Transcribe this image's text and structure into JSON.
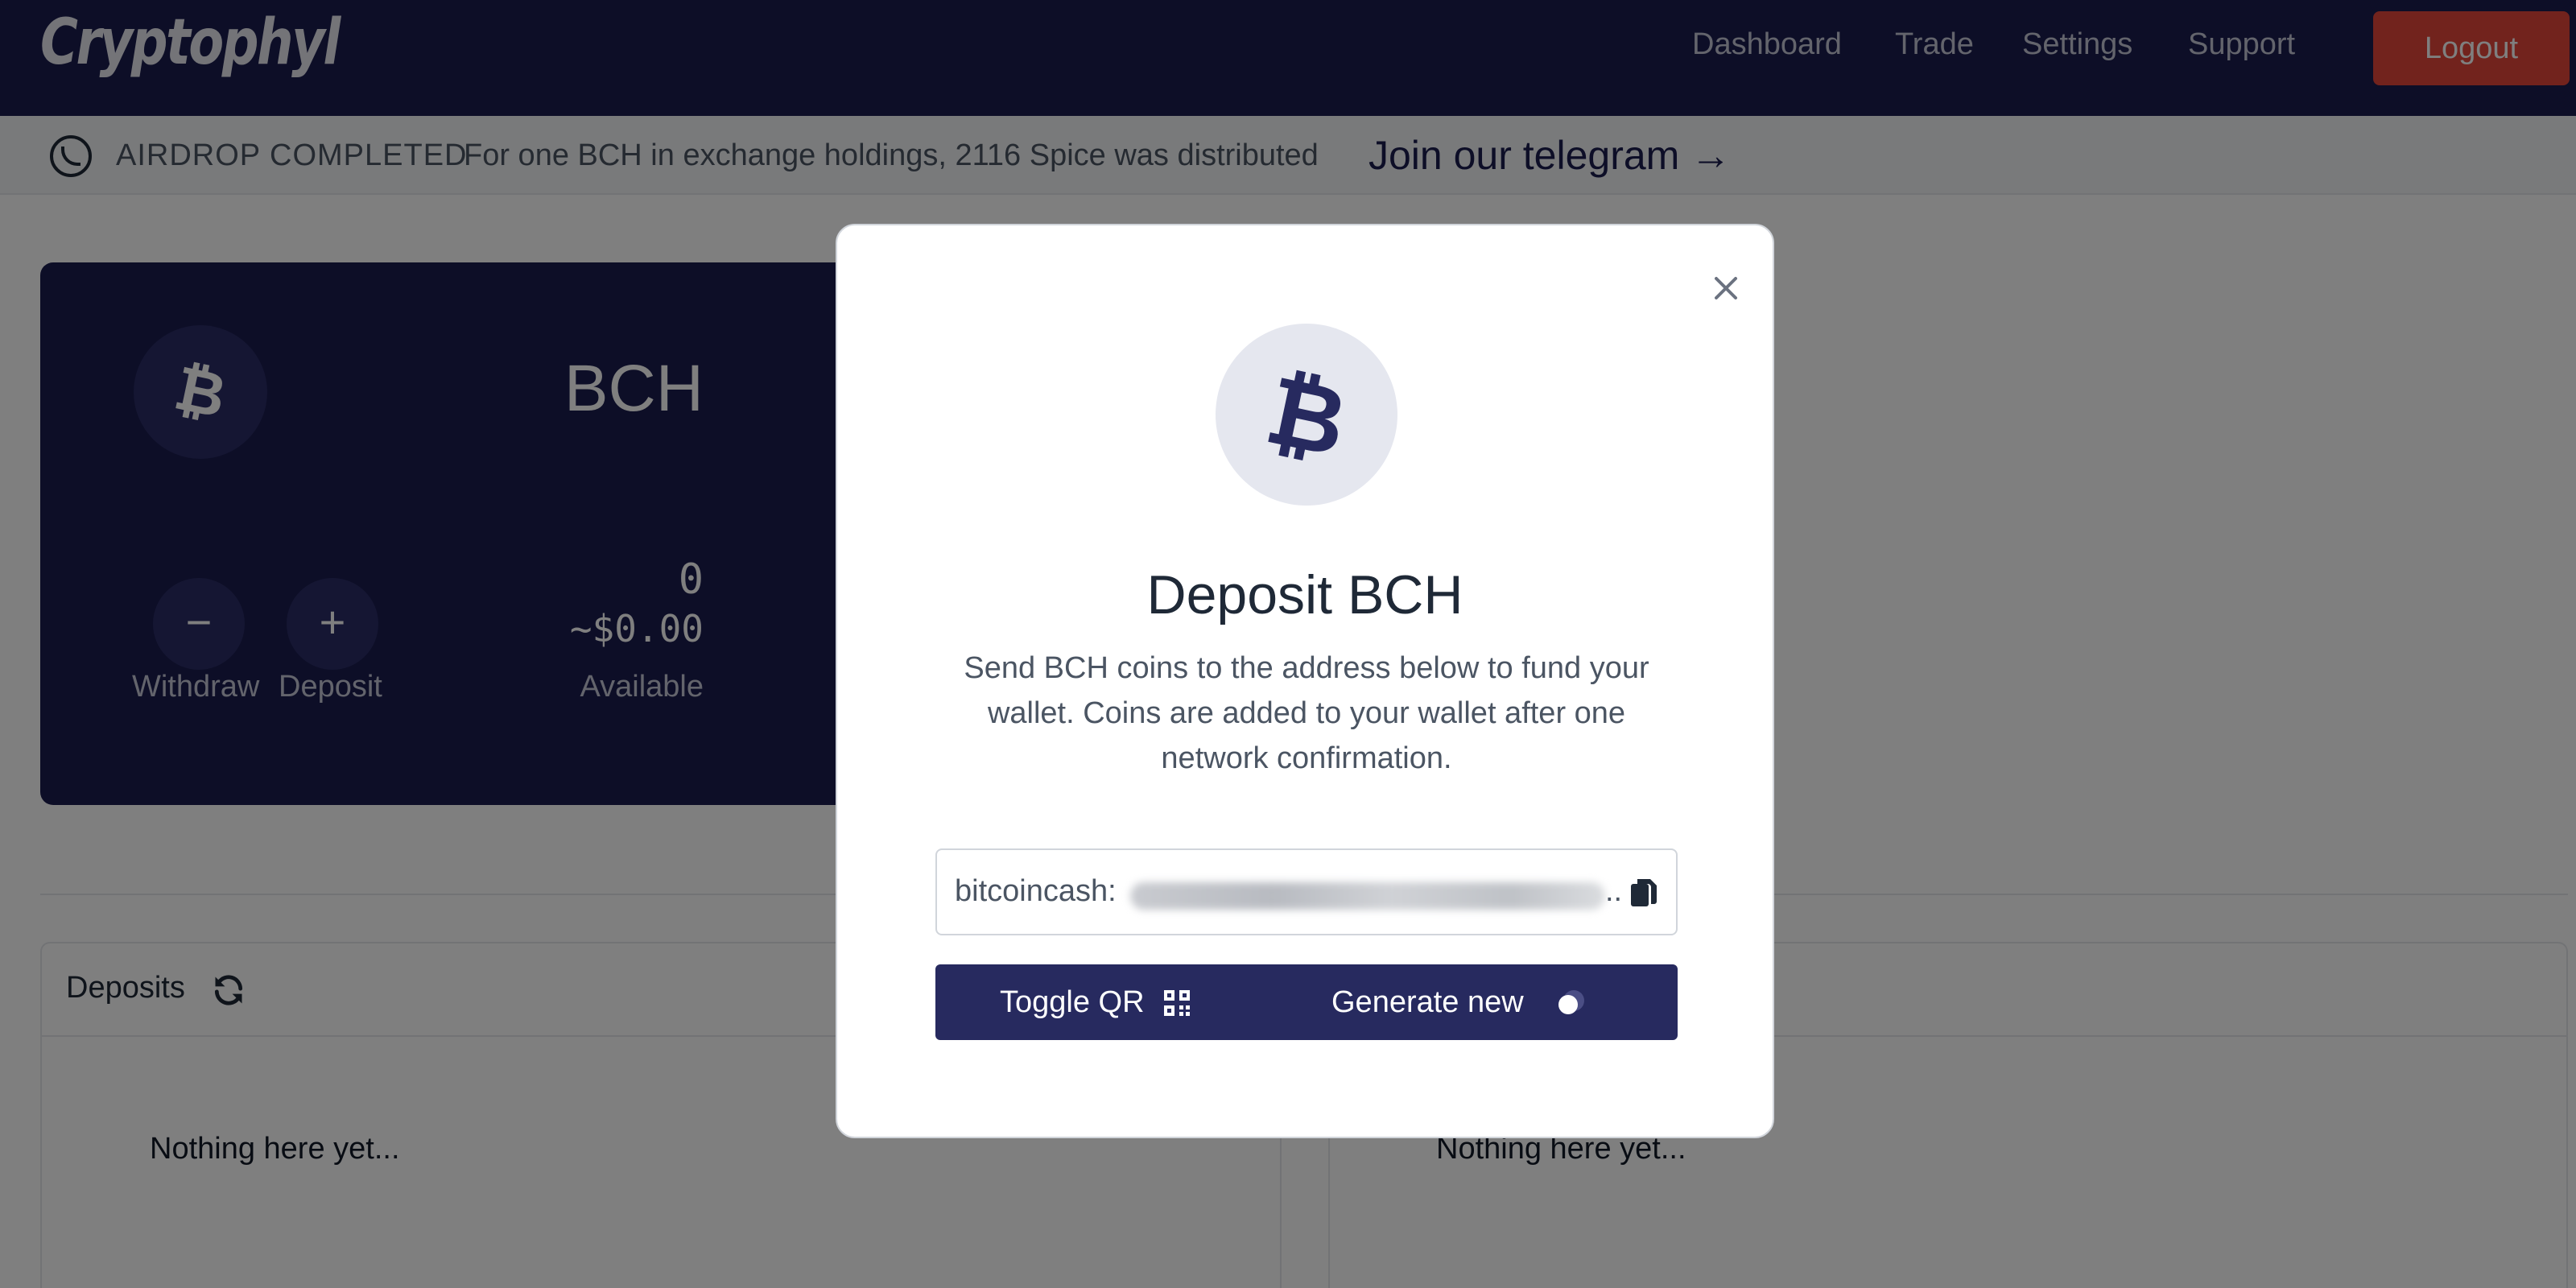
{
  "navbar": {
    "brand": "Cryptophyl",
    "links": [
      "Dashboard",
      "Trade",
      "Settings",
      "Support"
    ],
    "logout_label": "Logout"
  },
  "announcement": {
    "title": "AIRDROP COMPLETED",
    "text": "For one BCH in exchange holdings, 2116 Spice was distributed",
    "link": "Join our telegram →"
  },
  "wallet": {
    "coin": "BCH",
    "coin_icon": "bitcoin-icon",
    "amount": "0",
    "amount_usd": "~$0.00",
    "available_label": "Available",
    "withdraw_label": "Withdraw",
    "deposit_label": "Deposit",
    "withdraw_glyph": "−",
    "deposit_glyph": "+"
  },
  "panels": {
    "deposits_title": "Deposits",
    "empty_left": "Nothing here yet...",
    "empty_right": "Nothing here yet..."
  },
  "modal": {
    "close_glyph": "×",
    "title": "Deposit BCH",
    "description": "Send BCH coins to the address below to fund your wallet. Coins are added to your wallet after one network confirmation.",
    "address_prefix": "bitcoincash:",
    "address_ellipsis": "..",
    "toggle_qr_label": "Toggle QR",
    "generate_new_label": "Generate new"
  },
  "colors": {
    "navy": "#1b1d4f",
    "logout_red": "#e4463b",
    "button_navy": "#272a5f"
  }
}
